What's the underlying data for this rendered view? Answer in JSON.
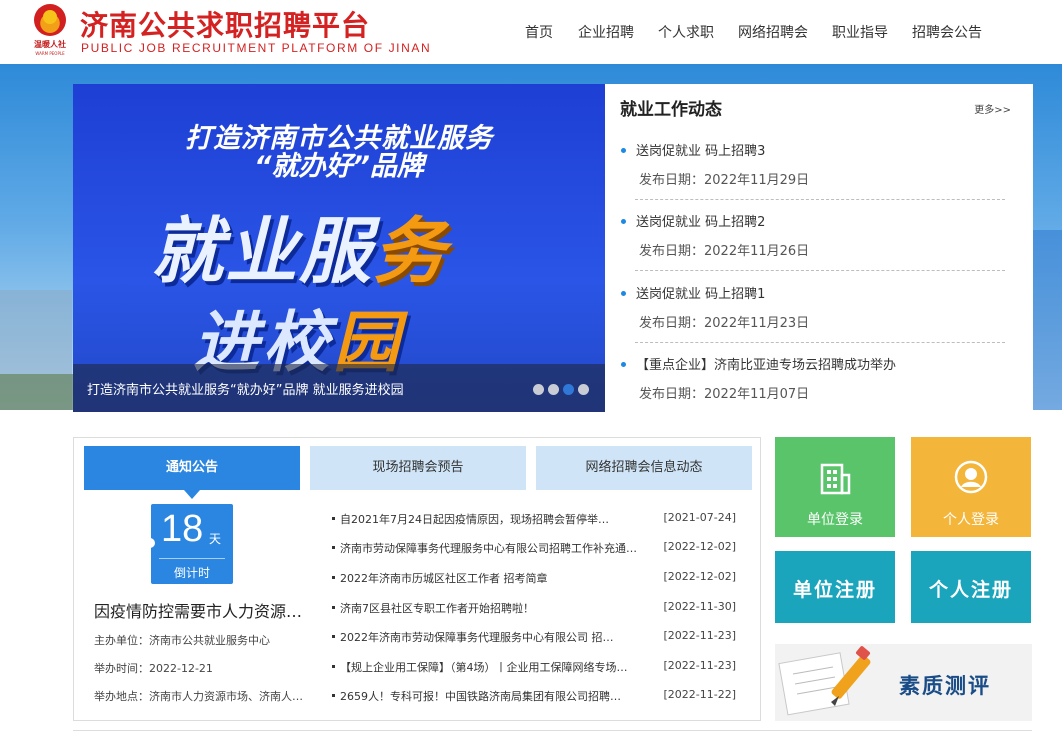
{
  "header": {
    "logo_text": "温暖人社",
    "logo_subtext": "WARM PEOPLE",
    "site_title": "济南公共求职招聘平台",
    "site_title_en": "PUBLIC JOB RECRUITMENT PLATFORM OF JINAN",
    "nav": [
      "首页",
      "企业招聘",
      "个人求职",
      "网络招聘会",
      "职业指导",
      "招聘会公告"
    ]
  },
  "slider": {
    "line1": "打造济南市公共就业服务",
    "line2": "“就办好”品牌",
    "big1_a": "就业服",
    "big1_b": "务",
    "big2_a": "进校",
    "big2_b": "园",
    "caption": "打造济南市公共就业服务“就办好”品牌 就业服务进校园",
    "dots": 4,
    "active_dot": 2
  },
  "news": {
    "title": "就业工作动态",
    "more": "更多>>",
    "items": [
      {
        "title": "送岗促就业 码上招聘3",
        "date": "发布日期：2022年11月29日"
      },
      {
        "title": "送岗促就业 码上招聘2",
        "date": "发布日期：2022年11月26日"
      },
      {
        "title": "送岗促就业 码上招聘1",
        "date": "发布日期：2022年11月23日"
      },
      {
        "title": "【重点企业】济南比亚迪专场云招聘成功举办",
        "date": "发布日期：2022年11月07日"
      }
    ]
  },
  "tabs": [
    "通知公告",
    "现场招聘会预告",
    "网络招聘会信息动态"
  ],
  "countdown": {
    "number": "18",
    "unit": "天",
    "label": "倒计时"
  },
  "notice": {
    "title": "因疫情防控需要市人力资源…",
    "organizer": "主办单位：济南市公共就业服务中心",
    "time": "举办时间：2022-12-21",
    "place": "举办地点：济南市人力资源市场、济南人…"
  },
  "list": [
    {
      "text": "自2021年7月24日起因疫情原因，现场招聘会暂停举…",
      "date": "[2021-07-24]"
    },
    {
      "text": "济南市劳动保障事务代理服务中心有限公司招聘工作补充通…",
      "date": "[2022-12-02]"
    },
    {
      "text": "2022年济南市历城区社区工作者 招考简章",
      "date": "[2022-12-02]"
    },
    {
      "text": "济南7区县社区专职工作者开始招聘啦！",
      "date": "[2022-11-30]"
    },
    {
      "text": "2022年济南市劳动保障事务代理服务中心有限公司 招…",
      "date": "[2022-11-23]"
    },
    {
      "text": "【规上企业用工保障】（第4场）丨企业用工保障网络专场…",
      "date": "[2022-11-23]"
    },
    {
      "text": "2659人！专科可报！中国铁路济南局集团有限公司招聘…",
      "date": "[2022-11-22]"
    }
  ],
  "tiles": {
    "unit_login": "单位登录",
    "personal_login": "个人登录",
    "unit_register": "单位注册",
    "personal_register": "个人注册",
    "quality": "素质测评"
  },
  "colors": {
    "brand_red": "#d42121",
    "accent_blue": "#2a86e0",
    "green": "#5ac46b",
    "orange": "#f3b53a",
    "teal": "#1aa5bd"
  }
}
